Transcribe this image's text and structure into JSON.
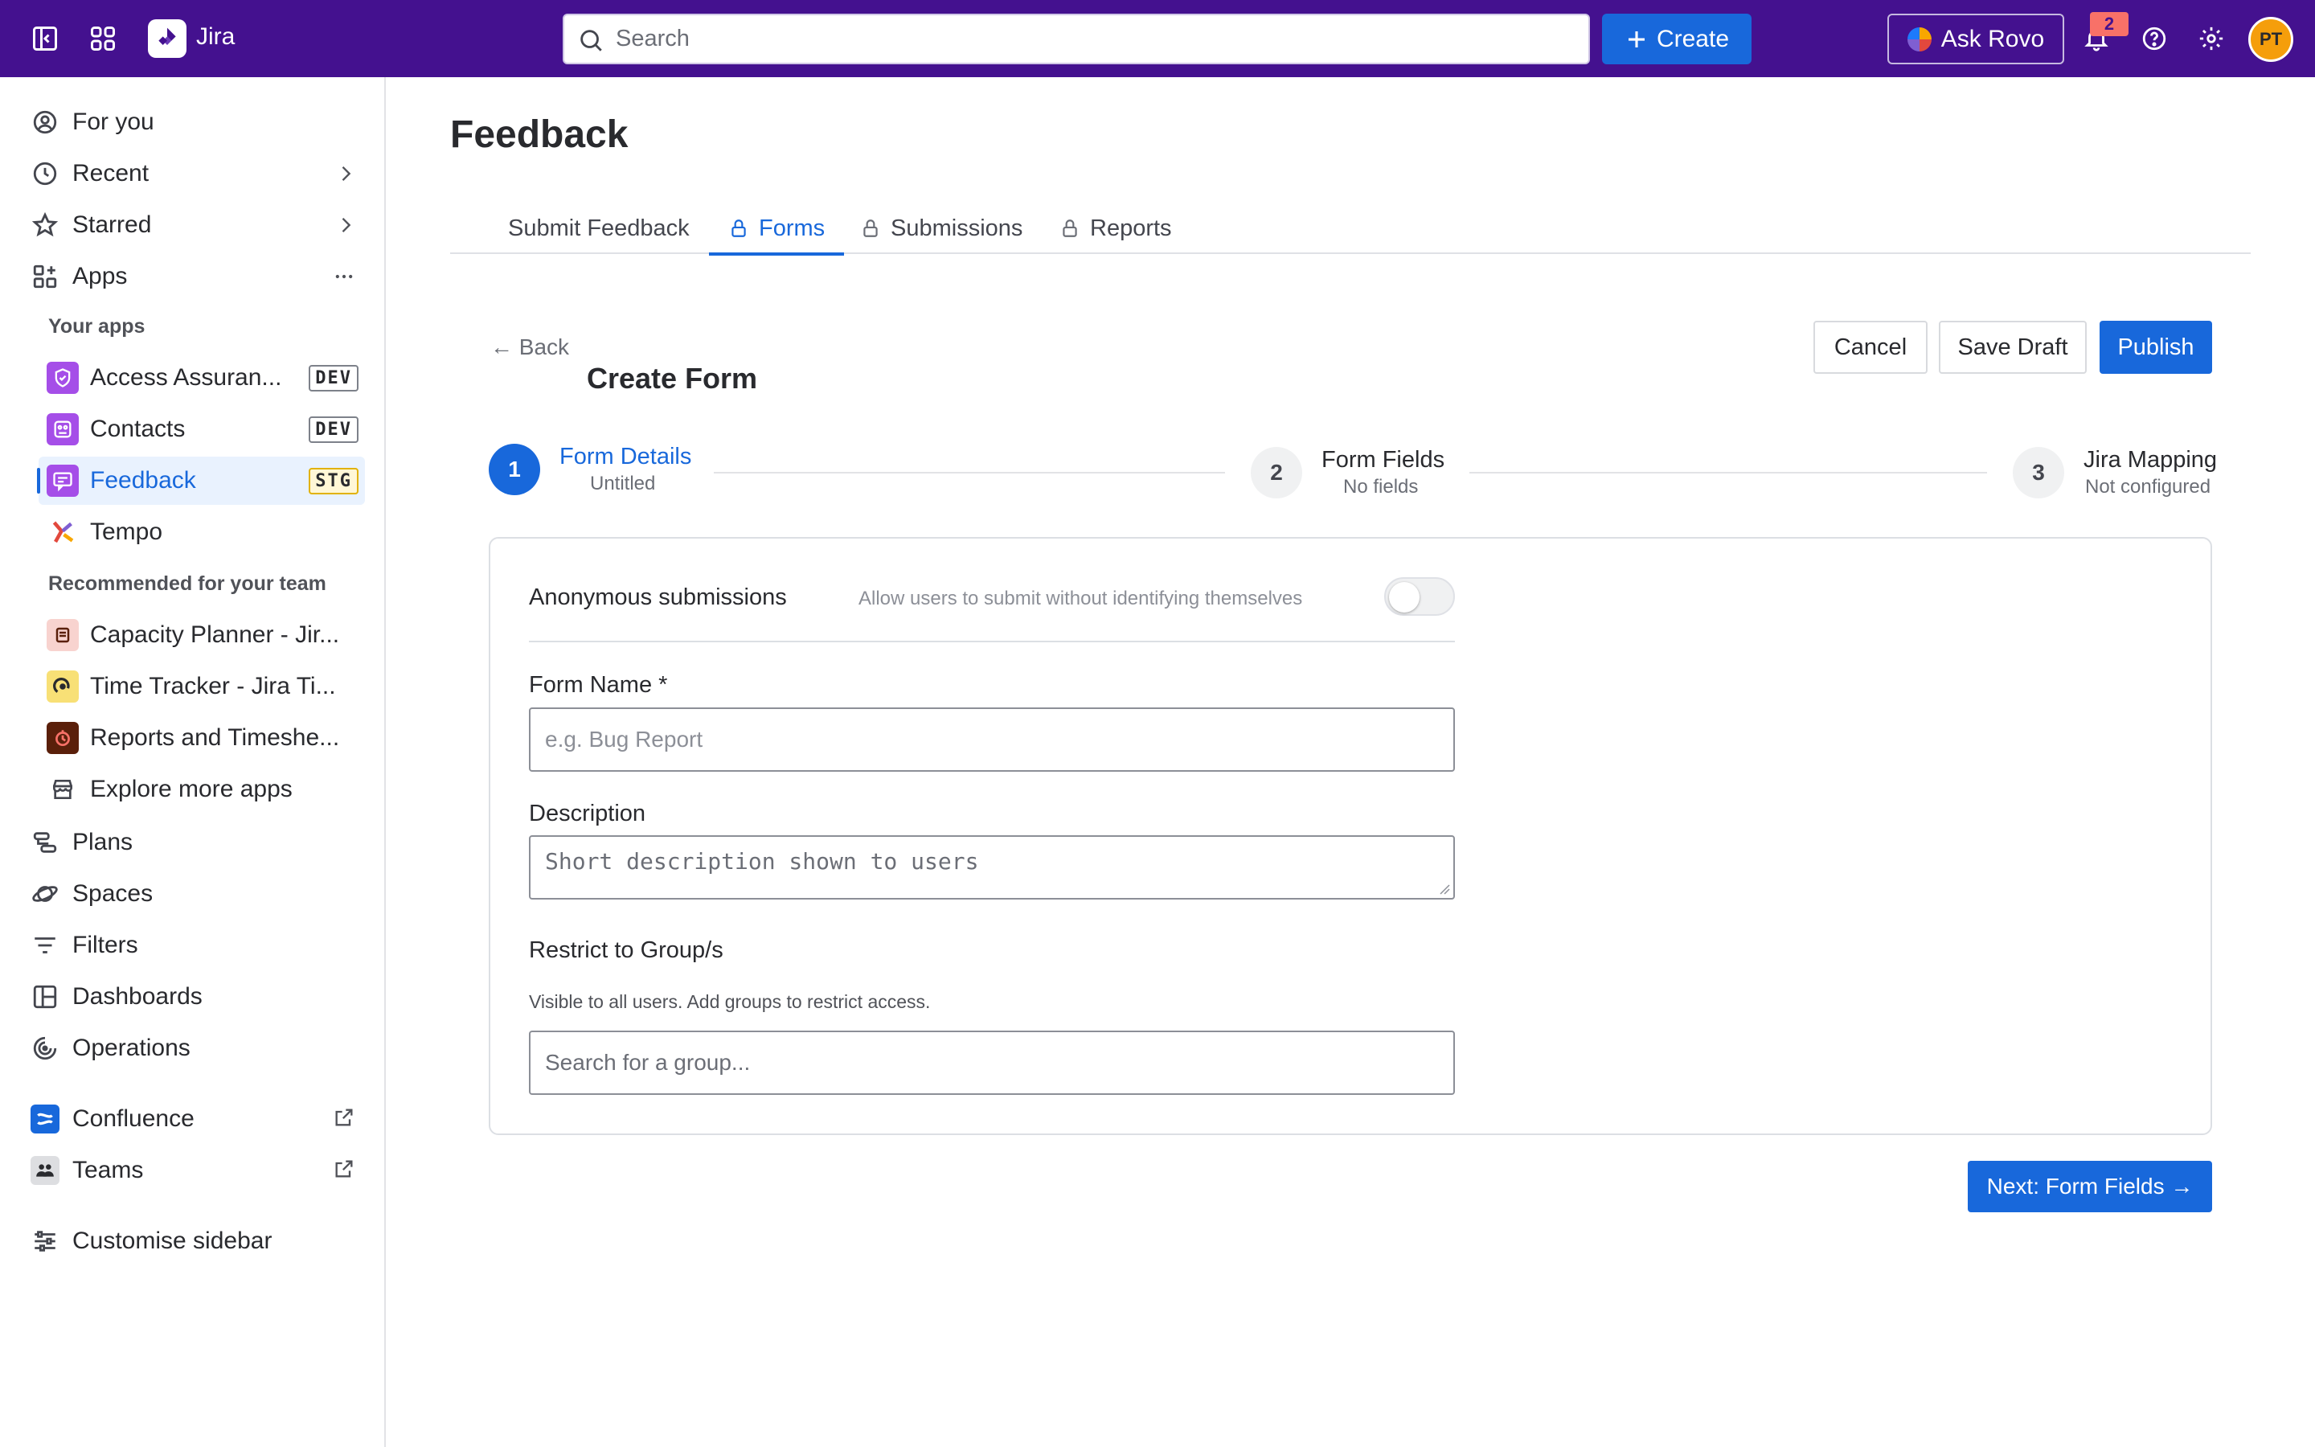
{
  "topbar": {
    "app_name": "Jira",
    "search_placeholder": "Search",
    "create_label": "Create",
    "rovo_label": "Ask Rovo",
    "notification_count": "2",
    "avatar_initials": "PT"
  },
  "sidebar": {
    "top_items": [
      {
        "label": "For you",
        "icon": "person-circle-icon"
      },
      {
        "label": "Recent",
        "icon": "clock-icon"
      },
      {
        "label": "Starred",
        "icon": "star-icon"
      },
      {
        "label": "Apps",
        "icon": "apps-icon"
      }
    ],
    "your_apps_label": "Your apps",
    "your_apps": [
      {
        "label": "Access Assuran...",
        "tag": "DEV",
        "color": "#a54ee8"
      },
      {
        "label": "Contacts",
        "tag": "DEV",
        "color": "#a54ee8"
      },
      {
        "label": "Feedback",
        "tag": "STG",
        "color": "#a54ee8"
      },
      {
        "label": "Tempo",
        "tag": "",
        "color": "#7f5fd2"
      }
    ],
    "recommended_label": "Recommended for your team",
    "recommended_apps": [
      {
        "label": "Capacity Planner - Jir...",
        "color": "#f8d3cf"
      },
      {
        "label": "Time Tracker - Jira Ti...",
        "color": "#f8e076"
      },
      {
        "label": "Reports and Timeshe...",
        "color": "#5a1f0a"
      },
      {
        "label": "Explore more apps",
        "color": "#ffffff"
      }
    ],
    "bottom_items": [
      {
        "label": "Plans",
        "icon": "plans-icon"
      },
      {
        "label": "Spaces",
        "icon": "spaces-icon"
      },
      {
        "label": "Filters",
        "icon": "filter-icon"
      },
      {
        "label": "Dashboards",
        "icon": "dashboard-icon"
      },
      {
        "label": "Operations",
        "icon": "operations-icon"
      }
    ],
    "external_items": [
      {
        "label": "Confluence",
        "icon": "confluence-icon"
      },
      {
        "label": "Teams",
        "icon": "teams-icon"
      }
    ],
    "customise_label": "Customise sidebar"
  },
  "main": {
    "page_title": "Feedback",
    "tabs": [
      {
        "label": "Submit Feedback"
      },
      {
        "label": "Forms"
      },
      {
        "label": "Submissions"
      },
      {
        "label": "Reports"
      }
    ],
    "back_label": "← Back",
    "form_title": "Create Form",
    "cancel_label": "Cancel",
    "save_draft_label": "Save Draft",
    "publish_label": "Publish",
    "steps": [
      {
        "num": "1",
        "title": "Form Details",
        "sub": "Untitled"
      },
      {
        "num": "2",
        "title": "Form Fields",
        "sub": "No fields"
      },
      {
        "num": "3",
        "title": "Jira Mapping",
        "sub": "Not configured"
      }
    ],
    "anon_label": "Anonymous submissions",
    "anon_hint": "Allow users to submit without identifying themselves",
    "form_name_label": "Form Name *",
    "form_name_placeholder": "e.g. Bug Report",
    "description_label": "Description",
    "description_placeholder": "Short description shown to users",
    "restrict_label": "Restrict to Group/s",
    "restrict_hint": "Visible to all users. Add groups to restrict access.",
    "group_placeholder": "Search for a group...",
    "next_label": "Next: Form Fields →"
  },
  "colors": {
    "topbar_bg": "#44118f",
    "accent": "#1868db"
  }
}
